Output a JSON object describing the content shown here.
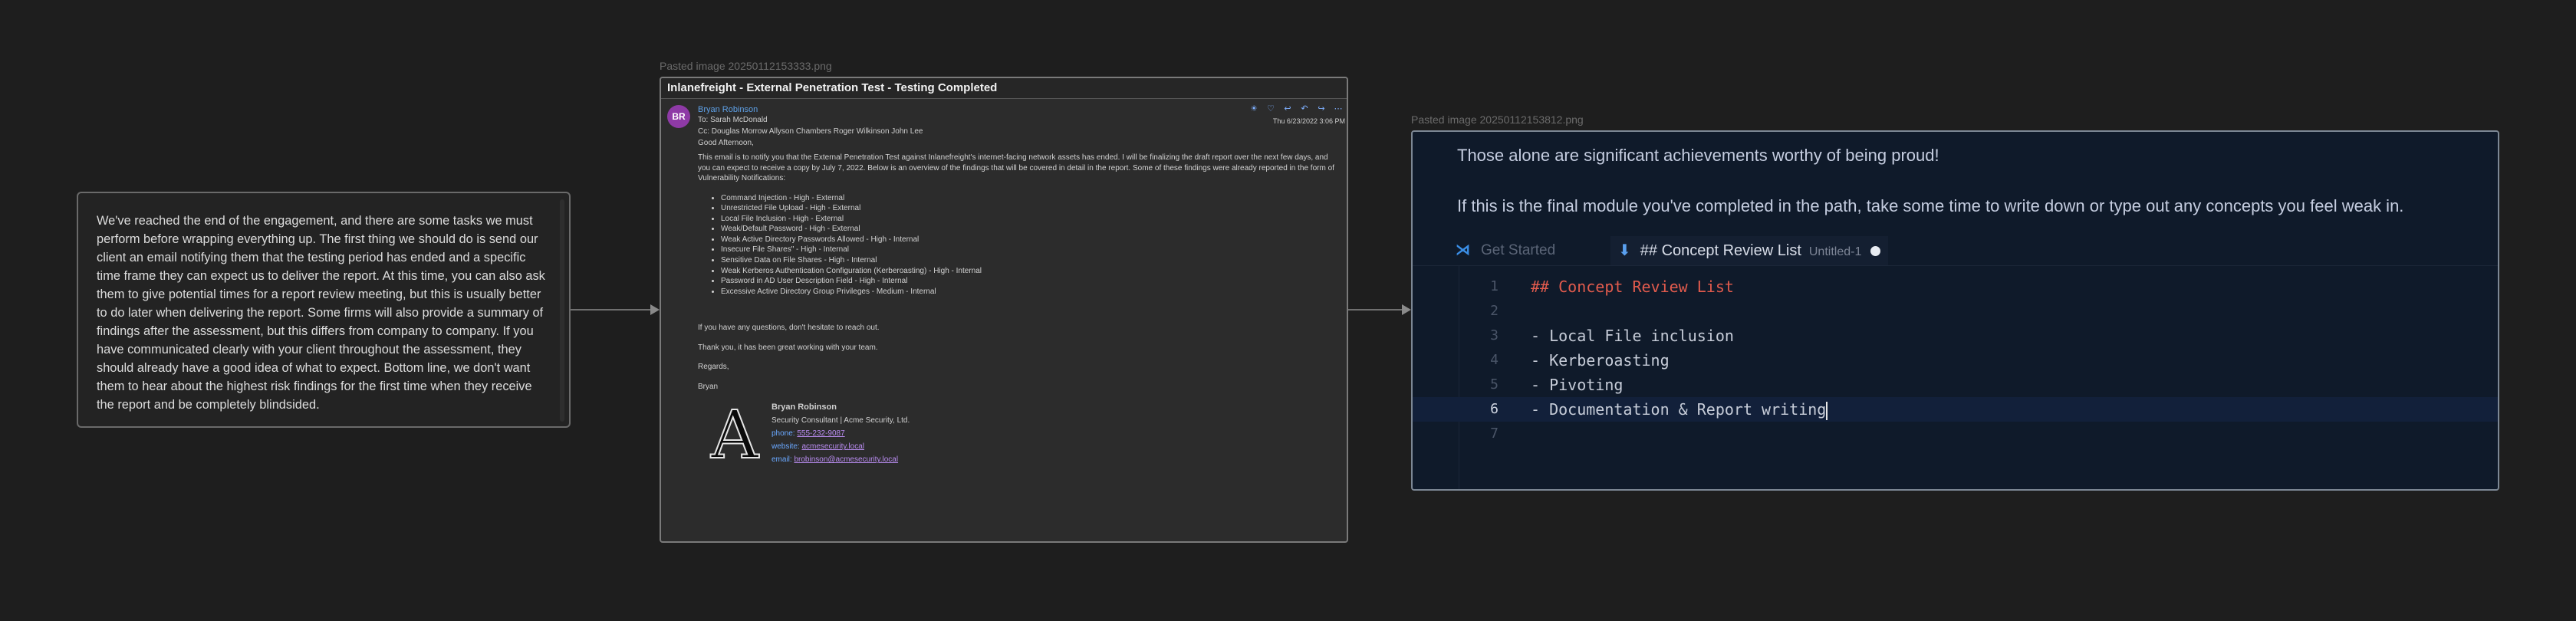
{
  "text_node": {
    "body": "We've reached the end of the engagement, and there are some tasks we must perform before wrapping everything up. The first thing we should do is send our client an email notifying them that the testing period has ended and a specific time frame they can expect us to deliver the report. At this time, you can also ask them to give potential times for a report review meeting, but this is usually better to do later when delivering the report. Some firms will also provide a summary of findings after the assessment, but this differs from company to company. If you have communicated clearly with your client throughout the assessment, they should already have a good idea of what to expect. Bottom line, we don't want them to hear about the highest risk findings for the first time when they receive the report and be completely blindsided."
  },
  "email_node": {
    "caption": "Pasted image 20250112153333.png",
    "subject": "Inlanefreight - External Penetration Test - Testing Completed",
    "avatar_initials": "BR",
    "sender": "Bryan Robinson",
    "to": "To:  Sarah McDonald",
    "cc": "Cc:  Douglas Morrow  Allyson Chambers  Roger Wilkinson  John Lee",
    "date": "Thu 6/23/2022 3:06 PM",
    "greeting": "Good Afternoon,",
    "intro": "This email is to notify you that the External Penetration Test against Inlanefreight's internet-facing network assets has ended. I will be finalizing the draft report over the next few days, and you can expect to receive a copy by July 7, 2022. Below is an overview of the findings that will be covered in detail in the report. Some of these findings were already reported in the form of Vulnerability Notifications:",
    "findings": [
      "Command Injection - High - External",
      "Unrestricted File Upload - High - External",
      "Local File Inclusion - High - External",
      "Weak/Default Password - High - External",
      "Weak Active Directory Passwords Allowed - High - Internal",
      "Insecure File Shares\" - High - Internal",
      "Sensitive Data on File Shares - High - Internal",
      "Weak Kerberos Authentication Configuration (Kerberoasting) - High - Internal",
      "Password in AD User Description Field - High - Internal",
      "Excessive Active Directory Group Privileges - Medium - Internal"
    ],
    "questions": "If you have any questions, don't hesitate to reach out.",
    "thanks": "Thank you, it has been great working with your team.",
    "regards": "Regards,",
    "signoff": "Bryan",
    "signature": {
      "logo_letter": "A",
      "name": "Bryan Robinson",
      "title": "Security Consultant | Acme Security, Ltd.",
      "phone_label": "phone:",
      "phone": "555-232-9087",
      "website_label": "website:",
      "website": "acmesecurity.local",
      "email_label": "email:",
      "email": "brobinson@acmesecurity.local"
    },
    "toolbar_icons": [
      "sun-icon",
      "heart-icon",
      "reply-icon",
      "reply-all-icon",
      "forward-icon",
      "more-icon"
    ]
  },
  "editor_node": {
    "caption": "Pasted image 20250112153812.png",
    "line1": "Those alone are significant achievements worthy of being proud!",
    "line2": "If this is the final module you've completed in the path, take some time to write down or type out any concepts you feel weak in.",
    "tab_inactive": "Get Started",
    "tab_active": "## Concept Review List",
    "tab_active_sub": "Untitled-1",
    "code_lines": [
      {
        "num": "1",
        "text": "## Concept Review List"
      },
      {
        "num": "2",
        "text": ""
      },
      {
        "num": "3",
        "text": "- Local File inclusion"
      },
      {
        "num": "4",
        "text": "- Kerberoasting"
      },
      {
        "num": "5",
        "text": "- Pivoting"
      },
      {
        "num": "6",
        "text": "- Documentation & Report writing"
      },
      {
        "num": "7",
        "text": ""
      }
    ]
  },
  "colors": {
    "canvas_bg": "#1e1e1e",
    "avatar": "#8e3aa6",
    "link": "#5ea0e6",
    "md_heading": "#e25b4d"
  }
}
